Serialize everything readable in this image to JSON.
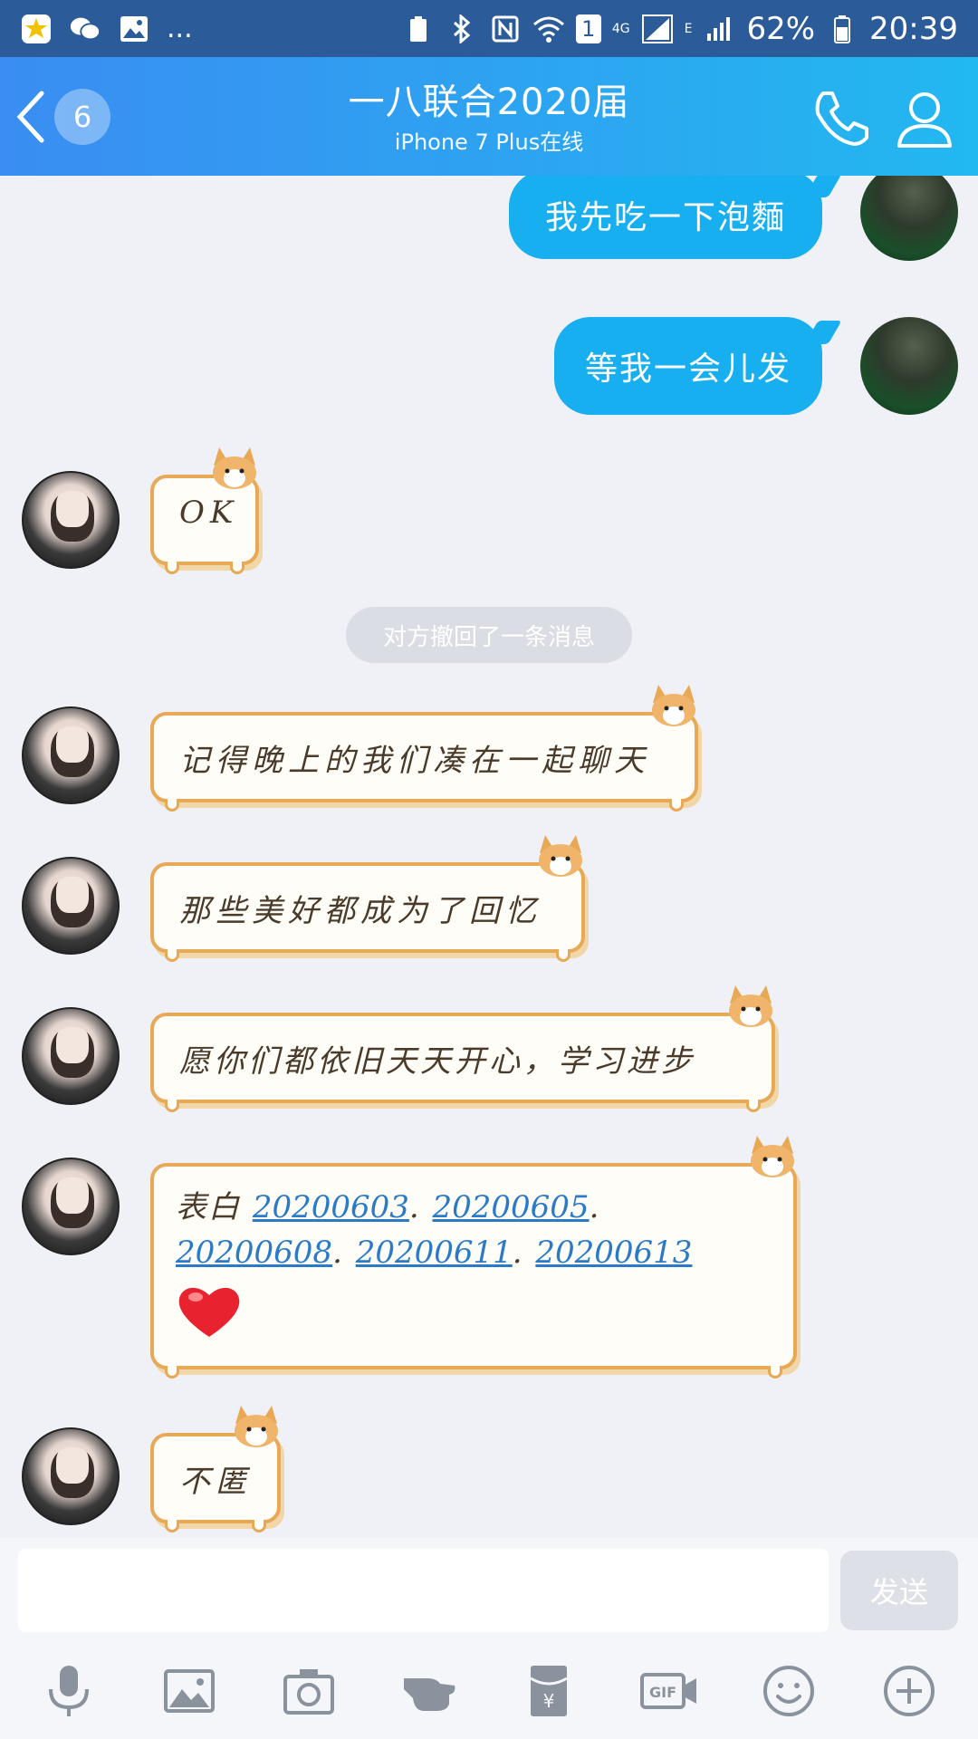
{
  "status_bar": {
    "battery": "62%",
    "time": "20:39",
    "sim_label": "1",
    "network": "4G",
    "network2": "E",
    "more": "..."
  },
  "header": {
    "unread_count": "6",
    "title": "一八联合2020届",
    "subtitle": "iPhone 7 Plus在线"
  },
  "messages": {
    "out_1": "我先吃一下泡麵",
    "out_2": "等我一会儿发",
    "in_1": "OK",
    "system": "对方撤回了一条消息",
    "in_2": "记得晚上的我们凑在一起聊天",
    "in_3": "那些美好都成为了回忆",
    "in_4": "愿你们都依旧天天开心，学习进步",
    "in_5_prefix": "表白",
    "in_5_links": [
      "20200603",
      "20200605",
      "20200608",
      "20200611",
      "20200613"
    ],
    "in_5_sep": ".",
    "in_6": "不匿"
  },
  "input": {
    "placeholder": "",
    "send_label": "发送"
  },
  "toolbar": {
    "gif_label": "GIF"
  },
  "colors": {
    "accent": "#17aff0",
    "header_start": "#3a8df2",
    "header_end": "#22b8f0",
    "bubble_border": "#e7a955"
  }
}
